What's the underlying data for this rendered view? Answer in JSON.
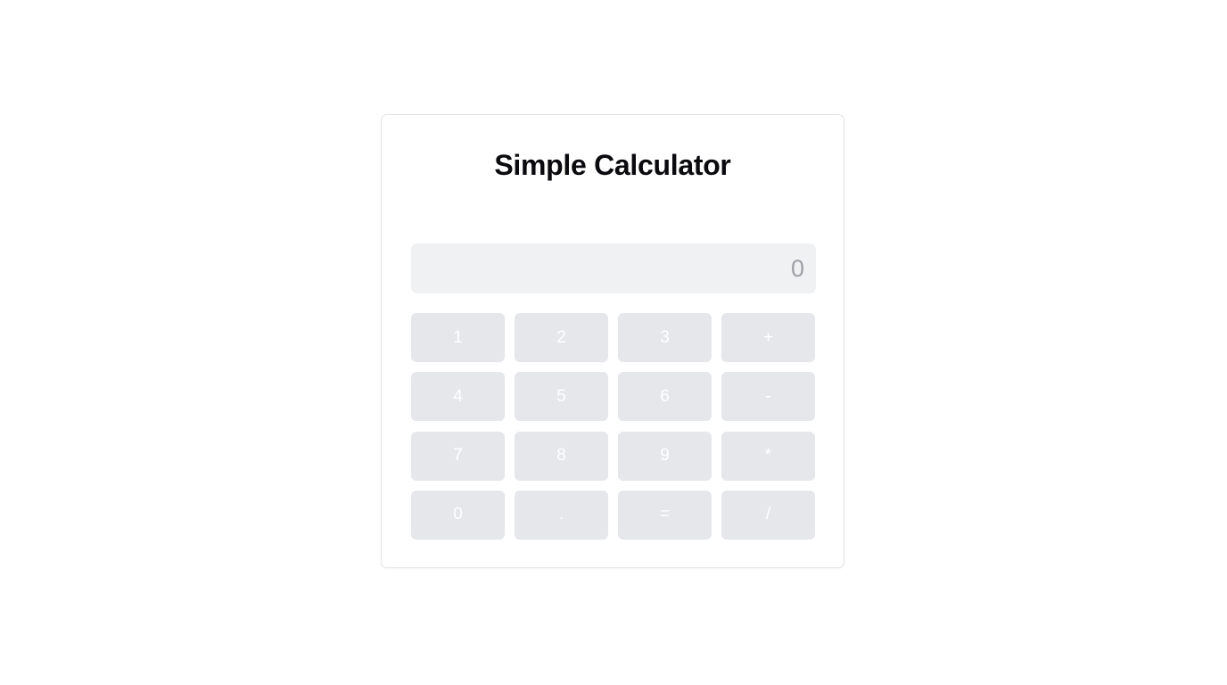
{
  "app": {
    "title": "Simple Calculator"
  },
  "display": {
    "value": "",
    "placeholder": "0"
  },
  "keypad": {
    "keys": [
      {
        "label": "1",
        "name": "key-1"
      },
      {
        "label": "2",
        "name": "key-2"
      },
      {
        "label": "3",
        "name": "key-3"
      },
      {
        "label": "+",
        "name": "key-plus"
      },
      {
        "label": "4",
        "name": "key-4"
      },
      {
        "label": "5",
        "name": "key-5"
      },
      {
        "label": "6",
        "name": "key-6"
      },
      {
        "label": "-",
        "name": "key-minus"
      },
      {
        "label": "7",
        "name": "key-7"
      },
      {
        "label": "8",
        "name": "key-8"
      },
      {
        "label": "9",
        "name": "key-9"
      },
      {
        "label": "*",
        "name": "key-multiply"
      },
      {
        "label": "0",
        "name": "key-0"
      },
      {
        "label": ".",
        "name": "key-decimal"
      },
      {
        "label": "=",
        "name": "key-equals"
      },
      {
        "label": "/",
        "name": "key-divide"
      }
    ]
  },
  "colors": {
    "title_text": "#0b0b0f",
    "display_background": "#f0f1f3",
    "display_placeholder": "#9ca0a6",
    "key_background": "#e5e7eb",
    "key_text": "#ffffff",
    "card_border": "#e3e4e7"
  }
}
